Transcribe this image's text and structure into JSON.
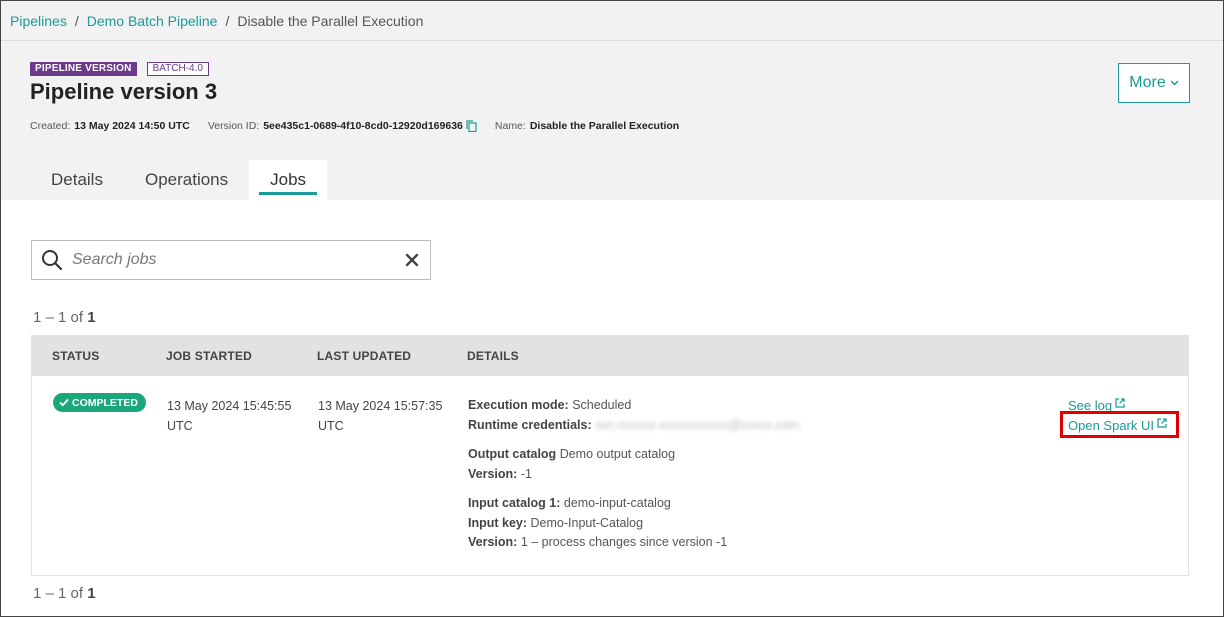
{
  "breadcrumb": {
    "items": [
      "Pipelines",
      "Demo Batch Pipeline"
    ],
    "current": "Disable the Parallel Execution",
    "separator": "/"
  },
  "header": {
    "badge_type": "PIPELINE VERSION",
    "badge_version": "BATCH-4.0",
    "title": "Pipeline version 3",
    "created_label": "Created:",
    "created_value": "13 May 2024 14:50 UTC",
    "version_label": "Version ID:",
    "version_value": "5ee435c1-0689-4f10-8cd0-12920d169636",
    "name_label": "Name:",
    "name_value": "Disable the Parallel Execution",
    "more_label": "More"
  },
  "tabs": [
    {
      "label": "Details"
    },
    {
      "label": "Operations"
    },
    {
      "label": "Jobs",
      "active": true
    }
  ],
  "search": {
    "placeholder": "Search jobs"
  },
  "pager_top": {
    "range": "1 – 1 of ",
    "total": "1"
  },
  "pager_bottom": {
    "range": "1 – 1 of ",
    "total": "1"
  },
  "table": {
    "columns": [
      "STATUS",
      "JOB STARTED",
      "LAST UPDATED",
      "DETAILS"
    ],
    "rows": [
      {
        "status": "COMPLETED",
        "started_line1": "13 May 2024 15:45:55",
        "started_line2": "UTC",
        "updated_line1": "13 May 2024 15:57:35",
        "updated_line2": "UTC",
        "exec_mode_label": "Execution mode:",
        "exec_mode_value": "Scheduled",
        "credentials_label": "Runtime credentials:",
        "credentials_value": "svc-xxxxxx-xxxxxxxxxxx@xxxxx.com",
        "output_catalog_label": "Output catalog",
        "output_catalog_value": "Demo output catalog",
        "output_version_label": "Version:",
        "output_version_value": "-1",
        "input_catalog_label": "Input catalog 1:",
        "input_catalog_value": "demo-input-catalog",
        "input_key_label": "Input key:",
        "input_key_value": "Demo-Input-Catalog",
        "input_version_label": "Version:",
        "input_version_value": "1 – process changes since version  -1",
        "see_log_label": "See log",
        "spark_ui_label": "Open Spark UI"
      }
    ]
  },
  "colors": {
    "accent": "#1a9a9a",
    "badge_purple": "#6b3a8c",
    "status_green": "#1aa77a",
    "highlight_red": "#e00000"
  },
  "icons": [
    "copy-icon",
    "search-icon",
    "close-icon",
    "check-icon",
    "external-link-icon",
    "chevron-down-icon"
  ]
}
